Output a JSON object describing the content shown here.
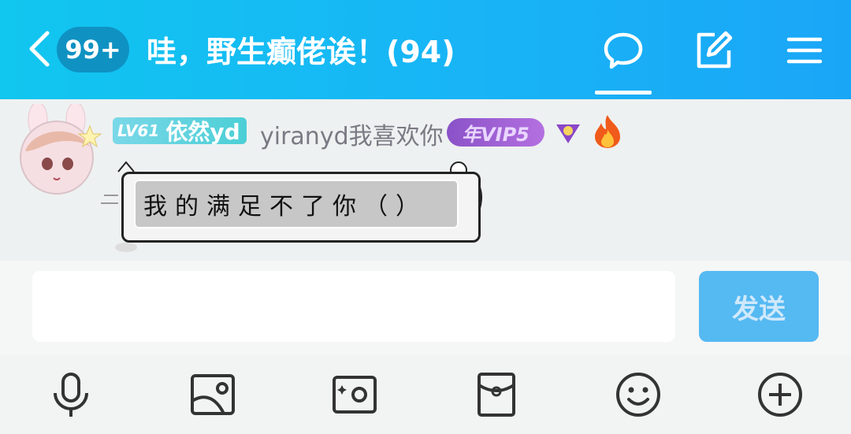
{
  "header": {
    "unread_badge": "99+",
    "title": "哇，野生癫佬诶！(94)",
    "icons": [
      "back-icon",
      "chat-bubble-icon",
      "edit-icon",
      "menu-icon"
    ]
  },
  "message": {
    "level_tag": "LV61",
    "group_name": "依然yd",
    "nickname": "yiranyd我喜欢你",
    "vip_badge": "年VIP5",
    "text": "我的满足不了你（）",
    "icons": [
      "avatar",
      "diamond-badge-icon",
      "fire-badge-icon"
    ]
  },
  "composer": {
    "input_value": "",
    "send_label": "发送"
  },
  "toolbar": {
    "items": [
      "microphone-icon",
      "image-icon",
      "camera-icon",
      "red-packet-icon",
      "emoji-icon",
      "plus-icon"
    ]
  },
  "colors": {
    "header_start": "#11c6ef",
    "header_end": "#1aa6f7",
    "send_button": "#55b9f2",
    "vip_purple": "#9b5fd6"
  }
}
